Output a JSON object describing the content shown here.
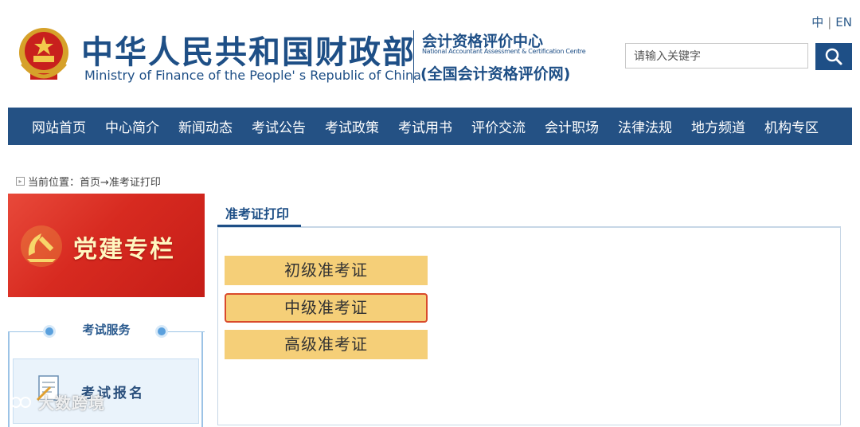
{
  "header": {
    "lang": {
      "zh": "中",
      "en": "EN"
    },
    "ministry_cn": "中华人民共和国财政部",
    "ministry_en": "Ministry of Finance of the People' s Republic of China",
    "center_cn": "会计资格评价中心",
    "center_en": "National Accountant Assessment & Certification Centre",
    "center_net": "(全国会计资格评价网)"
  },
  "search": {
    "placeholder": "请输入关键字",
    "icon": "search-icon"
  },
  "nav": {
    "items": [
      "网站首页",
      "中心简介",
      "新闻动态",
      "考试公告",
      "考试政策",
      "考试用书",
      "评价交流",
      "会计职场",
      "法律法规",
      "地方频道",
      "机构专区"
    ]
  },
  "breadcrumb": {
    "prefix": "当前位置：",
    "path": "首页→准考证打印"
  },
  "sidebar": {
    "banner_text": "党建专栏",
    "service_title": "考试服务",
    "signup_label": "考试报名"
  },
  "main": {
    "tab_title": "准考证打印",
    "buttons": [
      "初级准考证",
      "中级准考证",
      "高级准考证"
    ]
  },
  "watermark": "大数跨境",
  "colors": {
    "brand": "#1e4f86",
    "nav_bg": "#245184",
    "button": "#f5cf78",
    "highlight": "#d94a2b"
  }
}
